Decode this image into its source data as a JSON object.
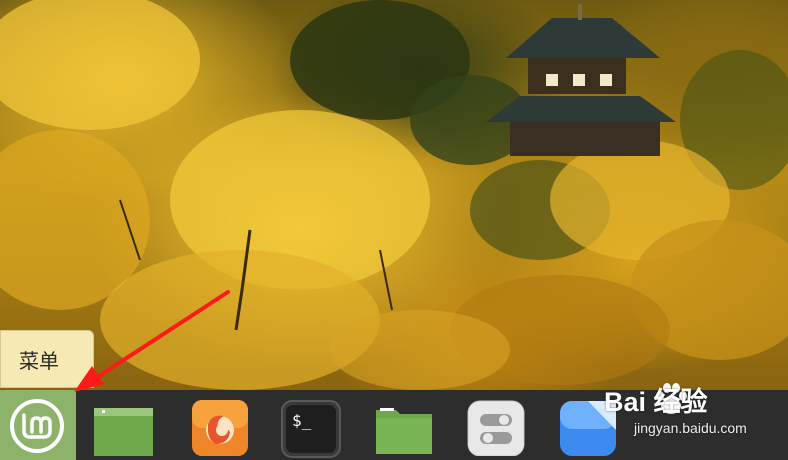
{
  "tooltip": {
    "text": "菜单"
  },
  "taskbar": {
    "menu": {
      "icon": "linux-mint-logo-icon",
      "color": "#8db26a"
    },
    "launchers": [
      {
        "name": "show-desktop",
        "icon": "show-desktop-icon"
      },
      {
        "name": "firefox",
        "icon": "firefox-icon"
      },
      {
        "name": "terminal",
        "icon": "terminal-icon",
        "glyph": "$_"
      },
      {
        "name": "files",
        "icon": "folder-icon"
      },
      {
        "name": "settings",
        "icon": "settings-toggle-icon"
      },
      {
        "name": "software-manager",
        "icon": "software-manager-icon"
      }
    ]
  },
  "watermark": {
    "main": "Bai 经验",
    "sub": "jingyan.baidu.com"
  },
  "annotation": {
    "arrow_color": "#ff1a1a"
  }
}
